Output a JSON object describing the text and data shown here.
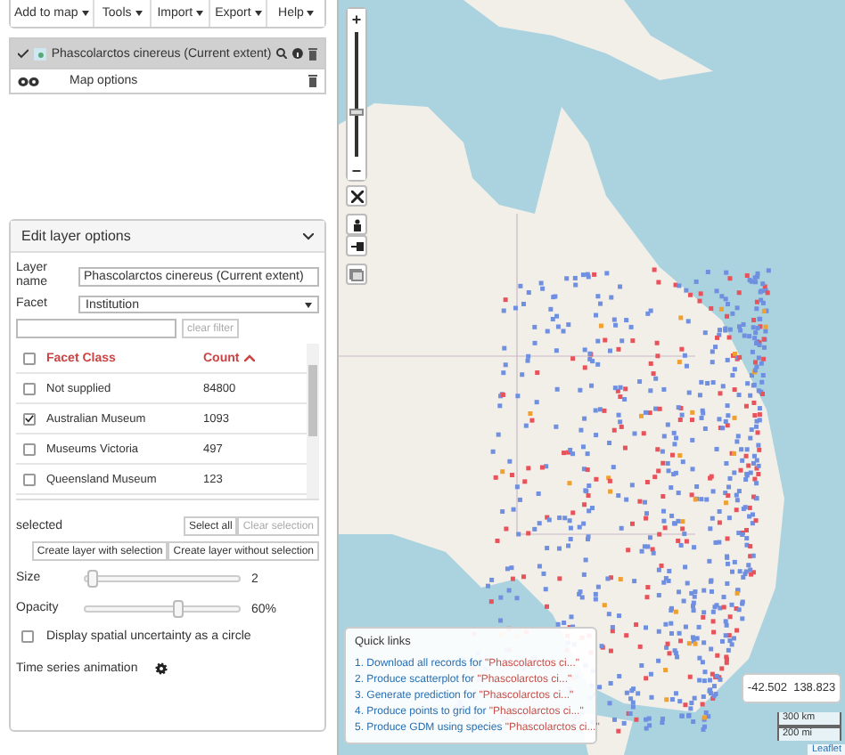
{
  "menu": [
    {
      "label": "Add to map"
    },
    {
      "label": "Tools"
    },
    {
      "label": "Import"
    },
    {
      "label": "Export"
    },
    {
      "label": "Help"
    }
  ],
  "layers": [
    {
      "kind": "species",
      "name": "Phascolarctos cinereus (Current extent)",
      "checked": true,
      "selected": true
    },
    {
      "kind": "options",
      "name": "Map options",
      "selected": false
    }
  ],
  "edit_panel": {
    "title": "Edit layer options",
    "expanded": true,
    "layer_name_label": "Layer name",
    "layer_name": "Phascolarctos cinereus (Current extent)",
    "facet_label": "Facet",
    "facet": "Institution",
    "clear_filter": "clear filter",
    "header_checked": false,
    "columns": [
      "Facet Class",
      "Count"
    ],
    "rows": [
      {
        "class": "Not supplied",
        "count": "84800",
        "checked": false
      },
      {
        "class": "Australian Museum",
        "count": "1093",
        "checked": true
      },
      {
        "class": "Museums Victoria",
        "count": "497",
        "checked": false
      },
      {
        "class": "Queensland Museum",
        "count": "123",
        "checked": false
      }
    ],
    "selected_label": "selected",
    "select_all": "Select all",
    "clear_selection": "Clear selection",
    "clear_disabled": true,
    "create_with": "Create layer with selection",
    "create_without": "Create layer without selection",
    "size": {
      "label": "Size",
      "level": 0.05,
      "reading": "2"
    },
    "opacity": {
      "label": "Opacity",
      "level": 0.6,
      "reading": "60%"
    },
    "uncertainty": {
      "label": "Display spatial uncertainty as a circle",
      "checked": false
    },
    "time_series": "Time series animation"
  },
  "map": {
    "zoom": {
      "plus": "+",
      "minus": "−",
      "level": 0.36
    },
    "quick_links": {
      "title": "Quick links",
      "items": [
        {
          "action": "1. Download all records for ",
          "target": "\"Phascolarctos ci...\""
        },
        {
          "action": "2. Produce scatterplot for ",
          "target": "\"Phascolarctos ci...\""
        },
        {
          "action": "3. Generate prediction for ",
          "target": "\"Phascolarctos ci...\""
        },
        {
          "action": "4. Produce points to grid for ",
          "target": "\"Phascolarctos ci...\""
        },
        {
          "action": "5. Produce GDM using species ",
          "target": "\"Phascolarctos ci...\""
        }
      ]
    },
    "coordinates": "-42.502  138.823",
    "scale": [
      "300 km",
      "200 mi"
    ],
    "attribution": "Leaflet"
  }
}
